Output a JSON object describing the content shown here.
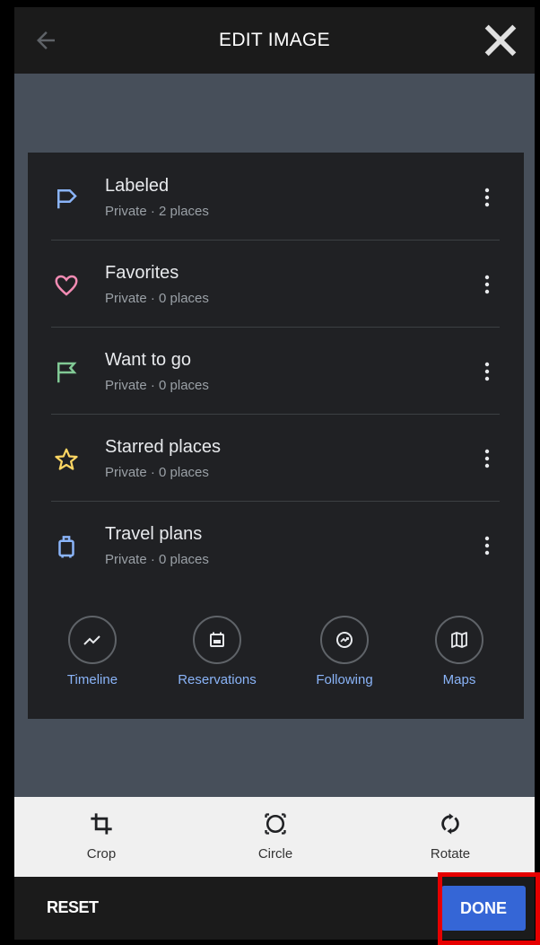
{
  "header": {
    "title": "EDIT IMAGE",
    "back_icon": "arrow-left-icon",
    "close_icon": "close-x-icon"
  },
  "lists": [
    {
      "name": "Labeled",
      "meta": "Private · 2 places",
      "icon": "label-flag-icon",
      "color": "#8ab4f8"
    },
    {
      "name": "Favorites",
      "meta": "Private · 0 places",
      "icon": "heart-icon",
      "color": "#f28bb3"
    },
    {
      "name": "Want to go",
      "meta": "Private · 0 places",
      "icon": "flag-icon",
      "color": "#81c995"
    },
    {
      "name": "Starred places",
      "meta": "Private · 0 places",
      "icon": "star-icon",
      "color": "#fdd663"
    },
    {
      "name": "Travel plans",
      "meta": "Private · 0 places",
      "icon": "suitcase-icon",
      "color": "#8ab4f8"
    }
  ],
  "shortcuts": [
    {
      "label": "Timeline",
      "icon": "timeline-icon"
    },
    {
      "label": "Reservations",
      "icon": "calendar-icon"
    },
    {
      "label": "Following",
      "icon": "following-icon"
    },
    {
      "label": "Maps",
      "icon": "map-icon"
    }
  ],
  "tools": [
    {
      "label": "Crop",
      "icon": "crop-icon"
    },
    {
      "label": "Circle",
      "icon": "circle-crop-icon"
    },
    {
      "label": "Rotate",
      "icon": "rotate-icon"
    }
  ],
  "footer": {
    "reset_label": "RESET",
    "done_label": "DONE"
  },
  "colors": {
    "accent": "#3566d6",
    "highlight": "#e60000",
    "link": "#8ab4f8"
  }
}
